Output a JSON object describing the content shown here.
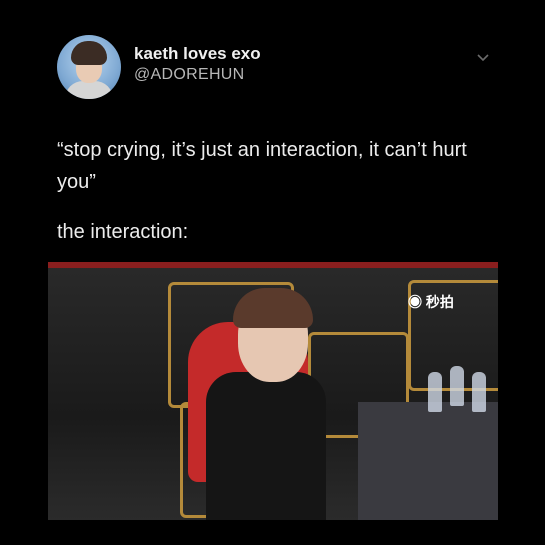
{
  "tweet": {
    "display_name": "kaeth loves exo",
    "handle": "@ADOREHUN",
    "text_line1": "“stop crying, it’s just an interaction, it can’t hurt you”",
    "text_line2": "the interaction:"
  },
  "media": {
    "watermark": "◉ 秒拍"
  },
  "colors": {
    "background": "#000000",
    "text": "#ececec",
    "handle": "#b7b7b7"
  }
}
